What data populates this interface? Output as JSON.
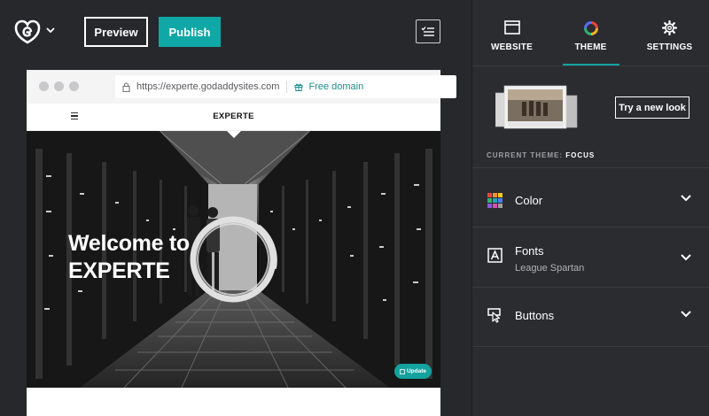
{
  "toolbar": {
    "preview_label": "Preview",
    "publish_label": "Publish",
    "accent_color": "#10a8a6"
  },
  "browser": {
    "url": "https://experte.godaddysites.com",
    "free_domain_label": "Free domain",
    "site_title": "EXPERTE",
    "hero_title_line1": "Welcome to",
    "hero_title_line2": "EXPERTE",
    "update_label": "Update"
  },
  "panel": {
    "tabs": [
      {
        "label": "WEBSITE",
        "icon": "browser-window-icon"
      },
      {
        "label": "THEME",
        "icon": "color-wheel-icon",
        "active": true
      },
      {
        "label": "SETTINGS",
        "icon": "gear-icon"
      }
    ],
    "try_new_look_label": "Try a new look",
    "current_theme_label": "CURRENT THEME:",
    "current_theme_value": "FOCUS",
    "sections": [
      {
        "label": "Color",
        "icon": "color-palette-icon"
      },
      {
        "label": "Fonts",
        "sublabel": "League Spartan",
        "icon": "font-icon"
      },
      {
        "label": "Buttons",
        "icon": "button-cursor-icon"
      }
    ]
  }
}
